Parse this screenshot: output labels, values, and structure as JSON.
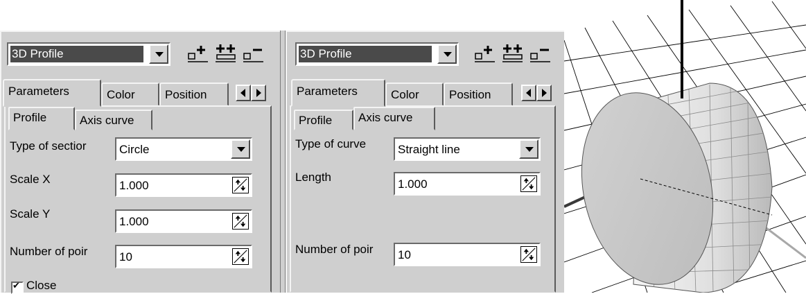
{
  "left_panel": {
    "profile_selector": {
      "value": "3D Profile"
    },
    "toolbar": {
      "icons": [
        "add-item-icon",
        "add-multiple-icon",
        "remove-item-icon"
      ]
    },
    "tabs": [
      "Parameters",
      "Color",
      "Position"
    ],
    "subtabs": [
      "Profile",
      "Axis curve"
    ],
    "active_subtab": "Profile",
    "fields": {
      "type_label": "Type of sectior",
      "type_value": "Circle",
      "scale_x_label": "Scale X",
      "scale_x_value": "1.000",
      "scale_y_label": "Scale Y",
      "scale_y_value": "1.000",
      "points_label": "Number of poir",
      "points_value": "10",
      "close_label": "Close",
      "close_checked": true
    }
  },
  "right_panel": {
    "profile_selector": {
      "value": "3D Profile"
    },
    "tabs": [
      "Parameters",
      "Color",
      "Position"
    ],
    "subtabs": [
      "Profile",
      "Axis curve"
    ],
    "active_subtab": "Axis curve",
    "fields": {
      "curve_label": "Type of curve",
      "curve_value": "Straight line",
      "length_label": "Length",
      "length_value": "1.000",
      "points_label": "Number of poir",
      "points_value": "10"
    }
  },
  "viewport": {
    "description_icon": "cylinder-3d-icon"
  },
  "colors": {
    "panel": "#cfcfcf",
    "selection": "#4a4a4a"
  }
}
